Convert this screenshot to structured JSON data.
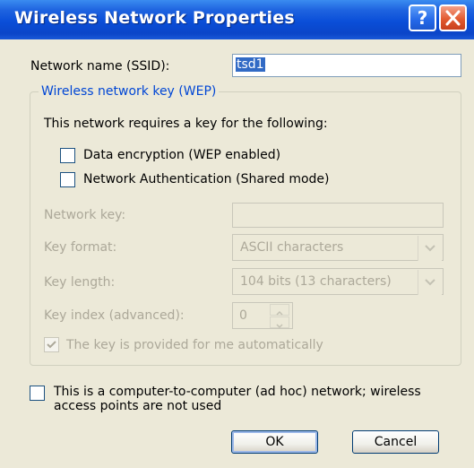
{
  "window": {
    "title": "Wireless Network Properties",
    "help_glyph": "?"
  },
  "ssid": {
    "label": "Network name (SSID):",
    "value": "tsd1"
  },
  "wep_group": {
    "legend": "Wireless network key (WEP)",
    "intro": "This network requires a key for the following:",
    "data_encryption_label": "Data encryption (WEP enabled)",
    "data_encryption_checked": false,
    "network_auth_label": "Network Authentication (Shared mode)",
    "network_auth_checked": false,
    "network_key_label": "Network key:",
    "network_key_value": "",
    "key_format_label": "Key format:",
    "key_format_value": "ASCII characters",
    "key_length_label": "Key length:",
    "key_length_value": "104 bits (13 characters)",
    "key_index_label": "Key index (advanced):",
    "key_index_value": "0",
    "auto_key_label": "The key is provided for me automatically",
    "auto_key_checked": true
  },
  "adhoc": {
    "label_line1": "This is a computer-to-computer (ad hoc) network; wireless",
    "label_line2": "access points are not used",
    "checked": false
  },
  "buttons": {
    "ok": "OK",
    "cancel": "Cancel"
  },
  "colors": {
    "title_bar": "#0a4ed8",
    "group_legend": "#0046d5",
    "dialog_bg": "#ece9d8",
    "disabled_text": "#aca899"
  }
}
